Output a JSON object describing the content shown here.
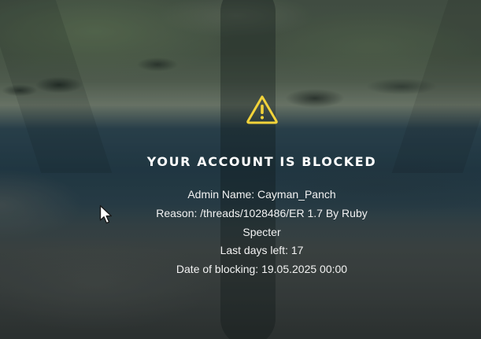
{
  "background": {
    "description_icon": "blurred-game-landscape"
  },
  "notice": {
    "icon": "warning-triangle-icon",
    "icon_color": "#f2d33a",
    "title": "YOUR ACCOUNT IS BLOCKED",
    "admin_name": "Admin Name: Cayman_Panch",
    "reason_line1": "Reason: /threads/1028486/ER 1.7 By Ruby",
    "reason_line2": "Specter",
    "days_left": "Last days left: 17",
    "date_of_blocking": "Date of blocking: 19.05.2025 00:00"
  },
  "cursor": {
    "icon": "mouse-pointer-icon"
  }
}
